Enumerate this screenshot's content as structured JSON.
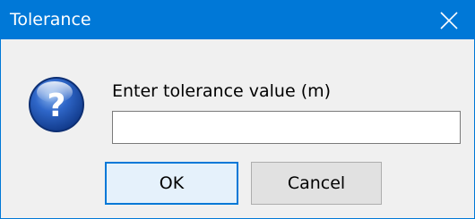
{
  "window": {
    "title": "Tolerance",
    "close_icon": "close-icon",
    "accent_color": "#0078d7"
  },
  "dialog": {
    "icon": "question-icon",
    "prompt": "Enter tolerance value (m)",
    "input": {
      "value": "",
      "placeholder": ""
    },
    "buttons": {
      "ok_label": "OK",
      "cancel_label": "Cancel"
    }
  }
}
